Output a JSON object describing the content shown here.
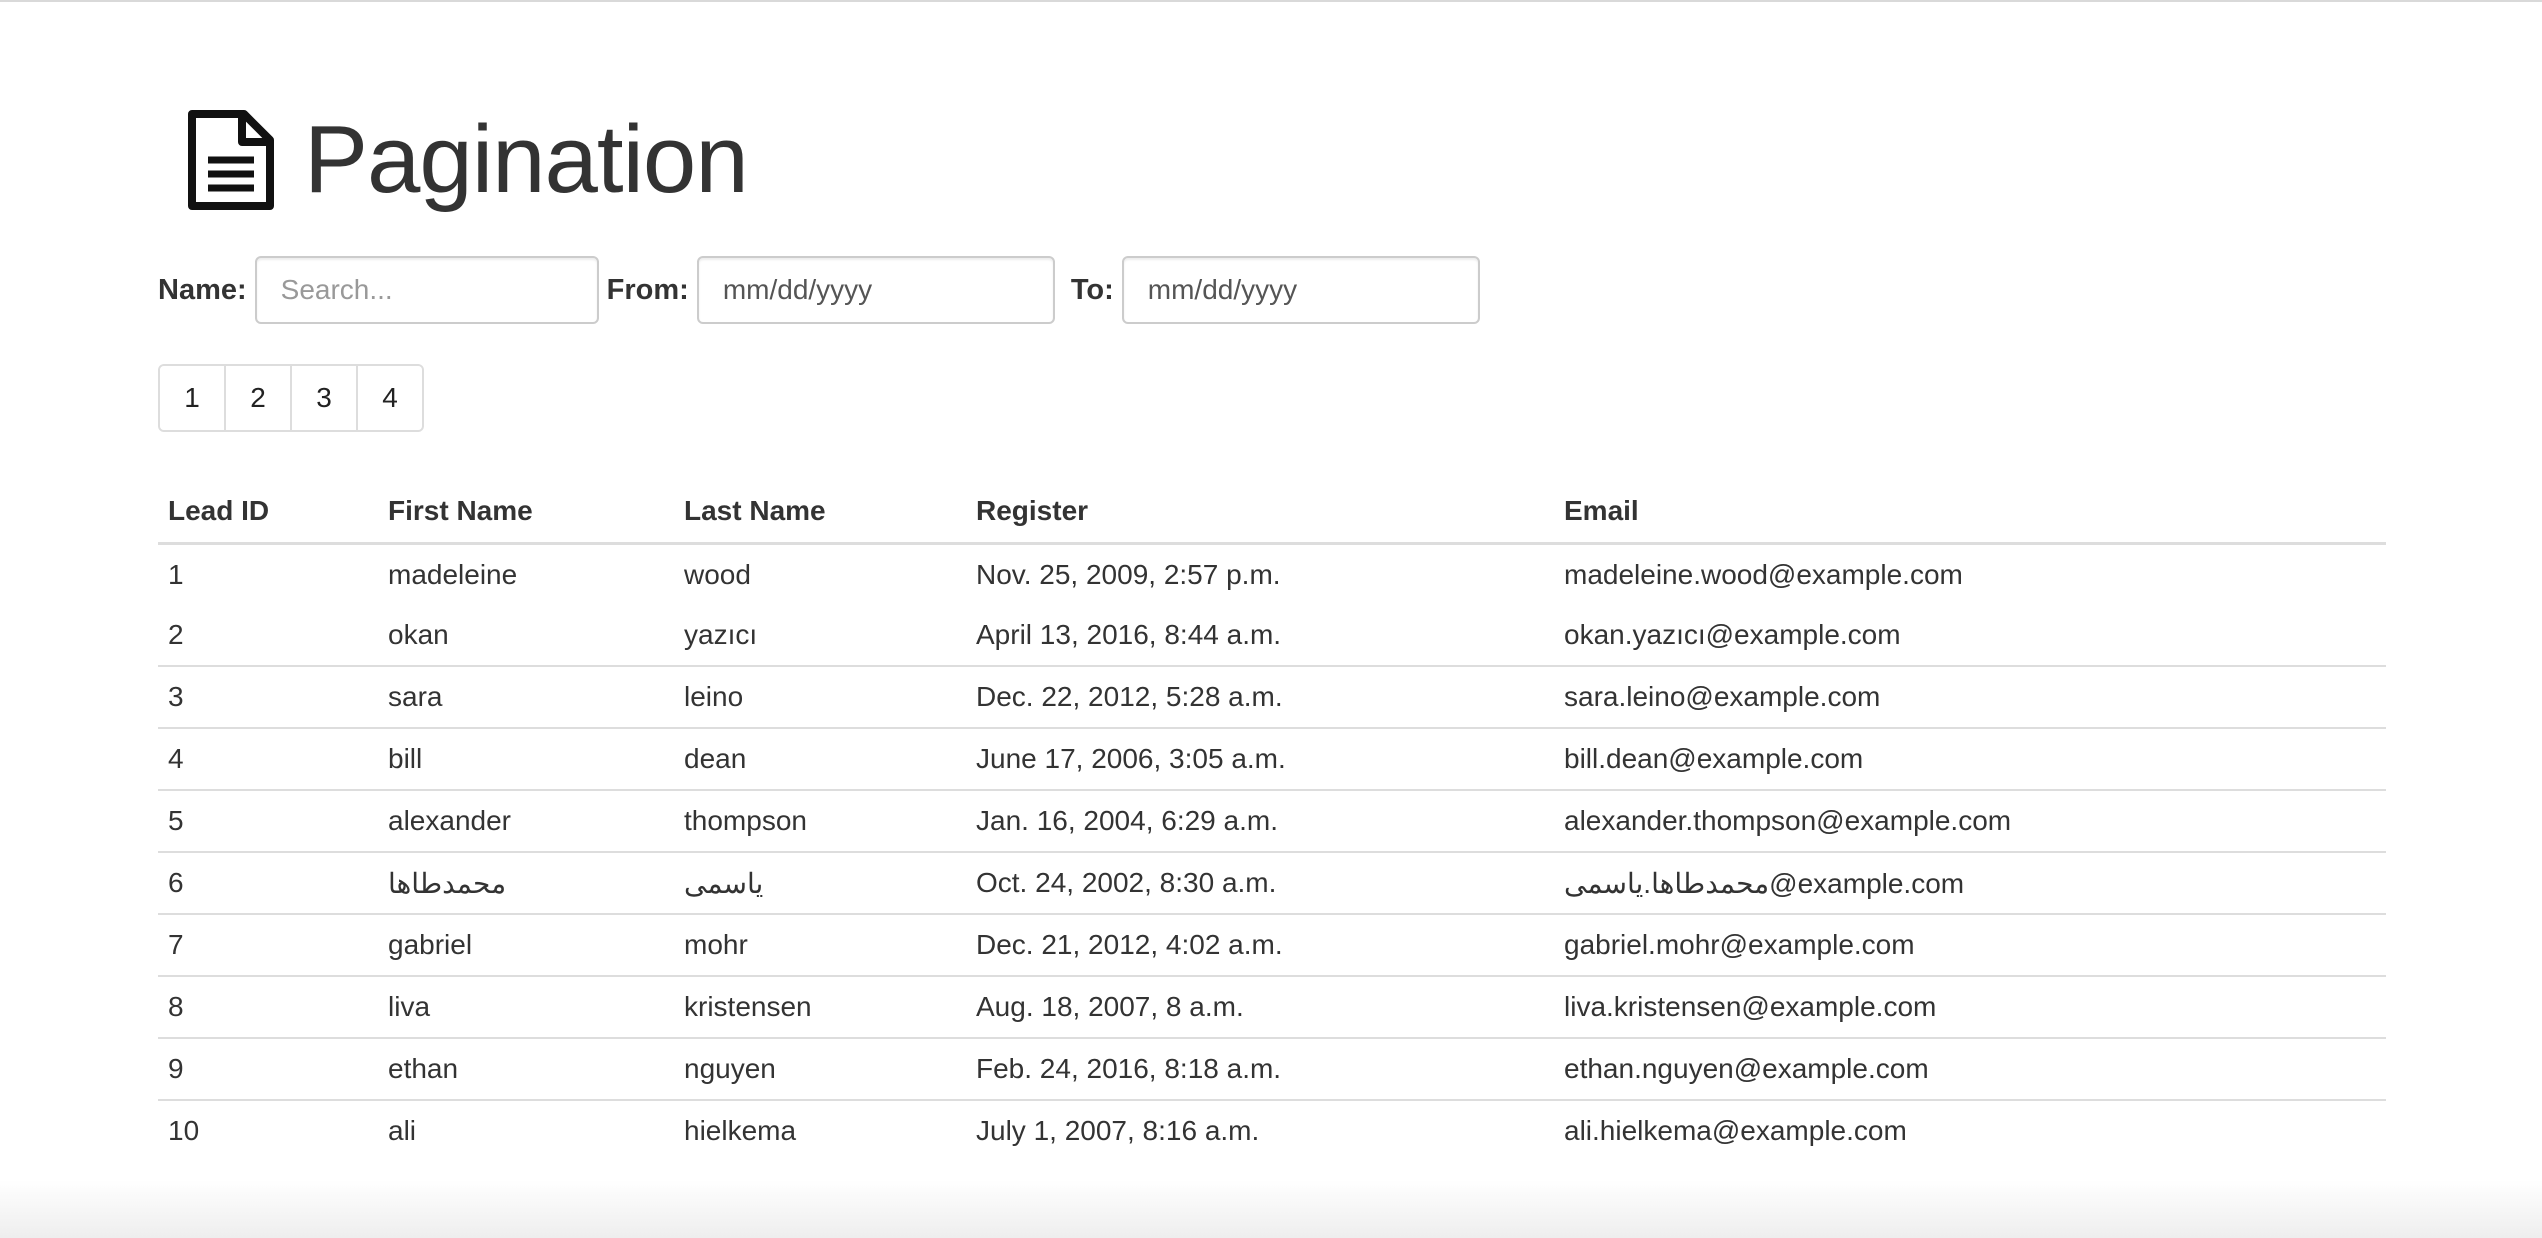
{
  "header": {
    "title": "Pagination",
    "icon": "document-icon"
  },
  "filters": {
    "name_label": "Name:",
    "name_placeholder": "Search...",
    "name_value": "",
    "from_label": "From:",
    "from_value": "mm/dd/yyyy",
    "to_label": "To:",
    "to_value": "mm/dd/yyyy"
  },
  "pagination": {
    "pages": [
      "1",
      "2",
      "3",
      "4"
    ]
  },
  "table": {
    "columns": [
      "Lead ID",
      "First Name",
      "Last Name",
      "Register",
      "Email"
    ],
    "rows": [
      [
        "1",
        "madeleine",
        "wood",
        "Nov. 25, 2009, 2:57 p.m.",
        "madeleine.wood@example.com"
      ],
      [
        "2",
        "okan",
        "yazıcı",
        "April 13, 2016, 8:44 a.m.",
        "okan.yazıcı@example.com"
      ],
      [
        "3",
        "sara",
        "leino",
        "Dec. 22, 2012, 5:28 a.m.",
        "sara.leino@example.com"
      ],
      [
        "4",
        "bill",
        "dean",
        "June 17, 2006, 3:05 a.m.",
        "bill.dean@example.com"
      ],
      [
        "5",
        "alexander",
        "thompson",
        "Jan. 16, 2004, 6:29 a.m.",
        "alexander.thompson@example.com"
      ],
      [
        "6",
        "محمدطاها",
        "یاسمی",
        "Oct. 24, 2002, 8:30 a.m.",
        "محمدطاها.یاسمی@example.com"
      ],
      [
        "7",
        "gabriel",
        "mohr",
        "Dec. 21, 2012, 4:02 a.m.",
        "gabriel.mohr@example.com"
      ],
      [
        "8",
        "liva",
        "kristensen",
        "Aug. 18, 2007, 8 a.m.",
        "liva.kristensen@example.com"
      ],
      [
        "9",
        "ethan",
        "nguyen",
        "Feb. 24, 2016, 8:18 a.m.",
        "ethan.nguyen@example.com"
      ],
      [
        "10",
        "ali",
        "hielkema",
        "July 1, 2007, 8:16 a.m.",
        "ali.hielkema@example.com"
      ]
    ]
  }
}
